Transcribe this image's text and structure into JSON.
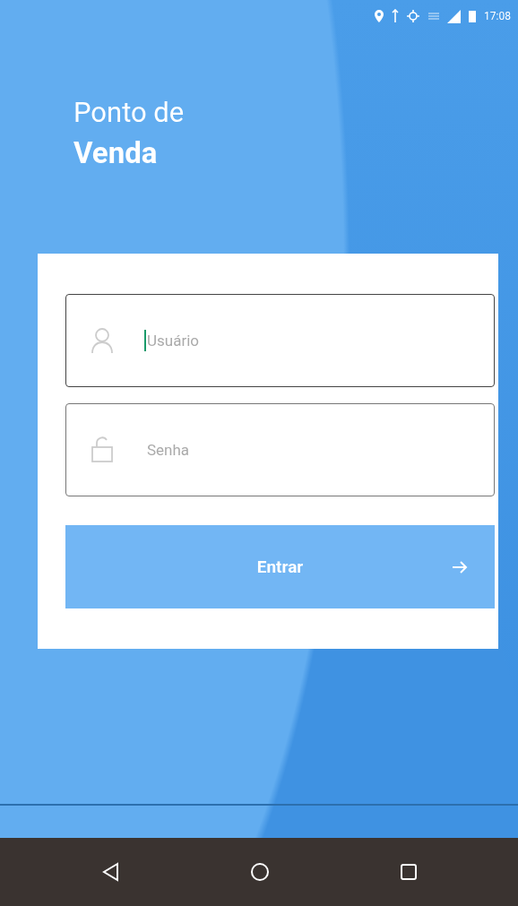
{
  "status_bar": {
    "time": "17:08"
  },
  "title": {
    "line_1": "Ponto de",
    "line_2": "Venda"
  },
  "login_form": {
    "fields": [
      {
        "kind": "user",
        "placeholder": "Usuário",
        "focused": true
      },
      {
        "kind": "password",
        "placeholder": "Senha",
        "focused": false
      }
    ],
    "button": {
      "label": "Entrar"
    }
  },
  "nav_bar": {
    "buttons": [
      {
        "kind": "back"
      },
      {
        "kind": "home"
      },
      {
        "kind": "recents"
      }
    ]
  }
}
